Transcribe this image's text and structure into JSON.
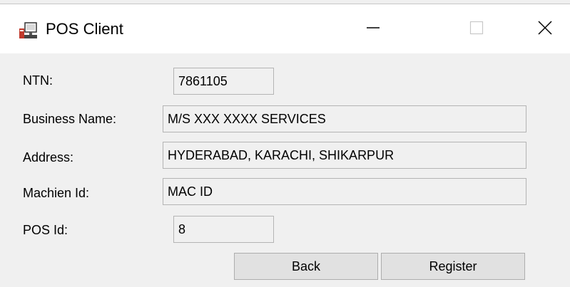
{
  "window": {
    "title": "POS Client"
  },
  "form": {
    "ntn": {
      "label": "NTN:",
      "value": "7861105"
    },
    "business_name": {
      "label": "Business Name:",
      "value": "M/S XXX XXXX SERVICES"
    },
    "address": {
      "label": "Address:",
      "value": "HYDERABAD, KARACHI, SHIKARPUR"
    },
    "machine_id": {
      "label": "Machien Id:",
      "value": "MAC ID"
    },
    "pos_id": {
      "label": "POS Id:",
      "value": "8"
    }
  },
  "buttons": {
    "back": "Back",
    "register": "Register"
  },
  "icons": {
    "app": "pos-terminal-icon",
    "minimize": "minimize-icon",
    "maximize": "maximize-icon",
    "close": "close-icon"
  },
  "colors": {
    "window_bg": "#f0f0f0",
    "titlebar_bg": "#ffffff",
    "field_border": "#b4b4b4",
    "button_bg": "#e1e1e1"
  }
}
